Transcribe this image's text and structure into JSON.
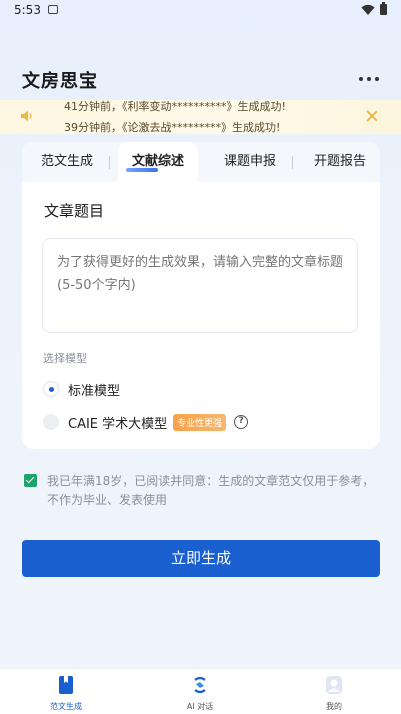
{
  "status_bar": {
    "time": "5:53"
  },
  "app": {
    "title": "文房思宝"
  },
  "notice": {
    "lines": [
      "41分钟前，《利率变动**********》生成成功!",
      "39分钟前，《论激去战*********》生成成功!"
    ]
  },
  "tabs": [
    {
      "label": "范文生成"
    },
    {
      "label": "文献综述"
    },
    {
      "label": "课题申报"
    },
    {
      "label": "开题报告"
    }
  ],
  "active_tab": "文献综述",
  "form": {
    "section_title": "文章题目",
    "title_placeholder": "为了获得更好的生成效果，请输入完整的文章标题 (5-50个字内)",
    "title_value": "",
    "model_label": "选择模型",
    "models": [
      {
        "label": "标准模型",
        "selected": true
      },
      {
        "label": "CAIE 学术大模型",
        "badge": "专业性更强",
        "selected": false
      }
    ]
  },
  "agreement": {
    "checked": true,
    "text": "我已年满18岁，已阅读并同意：生成的文章范文仅用于参考，不作为毕业、发表使用"
  },
  "generate_button": "立即生成",
  "bottom_nav": [
    {
      "label": "范文生成",
      "icon": "book-icon",
      "active": true
    },
    {
      "label": "AI 对话",
      "icon": "ai-chat-icon",
      "active": false
    },
    {
      "label": "我的",
      "icon": "profile-icon",
      "active": false
    }
  ],
  "colors": {
    "primary": "#1a5fd0",
    "accent_check": "#1aa56a",
    "badge_orange": "#f8a04a",
    "notice_bg": "#fdf6e0"
  }
}
